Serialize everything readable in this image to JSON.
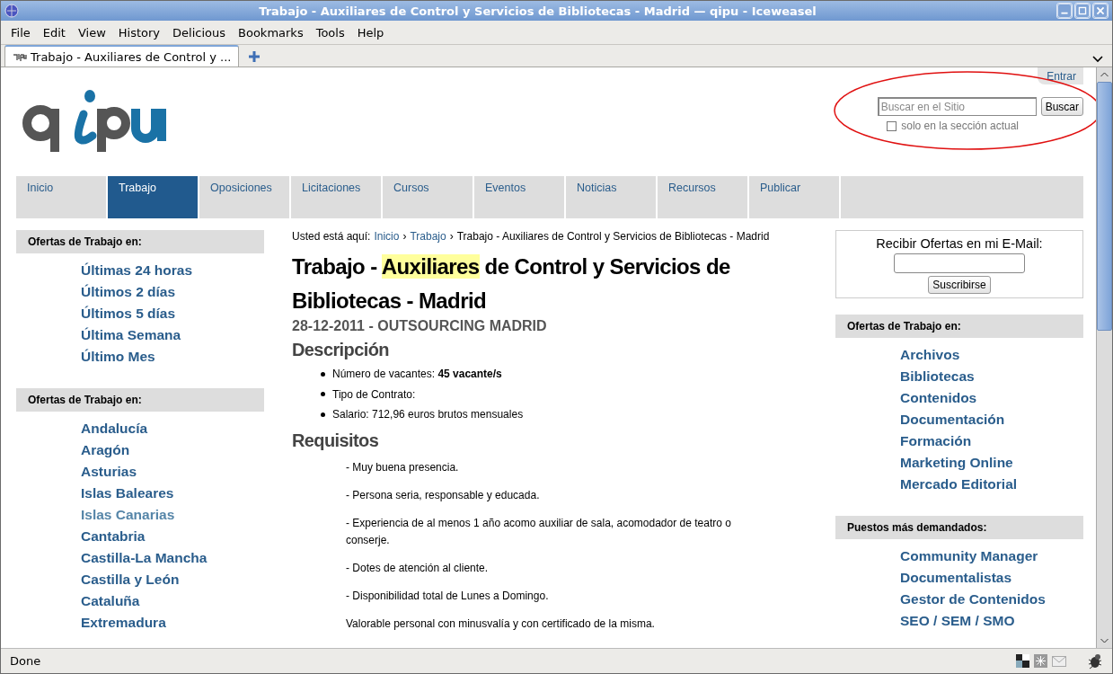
{
  "window": {
    "title": "Trabajo - Auxiliares de Control y Servicios de Bibliotecas - Madrid — qipu - Iceweasel"
  },
  "menu": [
    "File",
    "Edit",
    "View",
    "History",
    "Delicious",
    "Bookmarks",
    "Tools",
    "Help"
  ],
  "tabs": [
    {
      "label": "Trabajo - Auxiliares de Control y ...",
      "selected": true
    }
  ],
  "page": {
    "login": "Entrar",
    "search": {
      "placeholder": "Buscar en el Sitio",
      "button": "Buscar",
      "checkbox_label": "solo en la sección actual",
      "checked": false
    },
    "nav": [
      {
        "label": "Inicio",
        "selected": false
      },
      {
        "label": "Trabajo",
        "selected": true
      },
      {
        "label": "Oposiciones",
        "selected": false
      },
      {
        "label": "Licitaciones",
        "selected": false
      },
      {
        "label": "Cursos",
        "selected": false
      },
      {
        "label": "Eventos",
        "selected": false
      },
      {
        "label": "Noticias",
        "selected": false
      },
      {
        "label": "Recursos",
        "selected": false
      },
      {
        "label": "Publicar",
        "selected": false
      }
    ],
    "left_sections": [
      {
        "heading": "Ofertas de Trabajo en:",
        "links": [
          {
            "text": "Últimas 24 horas",
            "visited": false
          },
          {
            "text": "Últimos 2 días",
            "visited": false
          },
          {
            "text": "Últimos 5 días",
            "visited": false
          },
          {
            "text": "Última Semana",
            "visited": false
          },
          {
            "text": "Último Mes",
            "visited": false
          }
        ]
      },
      {
        "heading": "Ofertas de Trabajo en:",
        "links": [
          {
            "text": "Andalucía",
            "visited": false
          },
          {
            "text": "Aragón",
            "visited": false
          },
          {
            "text": "Asturias",
            "visited": false
          },
          {
            "text": "Islas Baleares",
            "visited": false
          },
          {
            "text": "Islas Canarias",
            "visited": true
          },
          {
            "text": "Cantabria",
            "visited": false
          },
          {
            "text": "Castilla-La Mancha",
            "visited": false
          },
          {
            "text": "Castilla y León",
            "visited": false
          },
          {
            "text": "Cataluña",
            "visited": false
          },
          {
            "text": "Extremadura",
            "visited": false
          }
        ]
      }
    ],
    "breadcrumb": {
      "label": "Usted está aquí:",
      "separator": "›",
      "items": [
        {
          "text": "Inicio",
          "link": true
        },
        {
          "text": "Trabajo",
          "link": true
        },
        {
          "text": "Trabajo - Auxiliares de Control y Servicios de Bibliotecas - Madrid",
          "link": false
        }
      ]
    },
    "heading": [
      {
        "text": "Trabajo - ",
        "highlighted": false
      },
      {
        "text": "Auxiliares",
        "highlighted": true
      },
      {
        "text": " de Control y Servicios de Bibliotecas - Madrid",
        "highlighted": false
      }
    ],
    "subtitle": "28-12-2011 - OUTSOURCING MADRID",
    "description_heading": "Descripción",
    "description": [
      "Número de vacantes: **45 vacante/s**",
      "Tipo de Contrato:",
      "Salario: 712,96 euros brutos mensuales"
    ],
    "requirements_heading": "Requisitos",
    "requirements": [
      "- Muy buena presencia.",
      "- Persona seria, responsable y educada.",
      "- Experiencia de al menos 1 año acomo auxiliar de sala, acomodador de teatro o conserje.",
      "- Dotes de atención al cliente.",
      "- Disponibilidad total de Lunes a Domingo."
    ],
    "note": "Valorable personal con minusvalía y con certificado de la misma.",
    "subscribe": {
      "label": "Recibir Ofertas en mi E-Mail:",
      "button": "Suscribirse"
    },
    "right_sections": [
      {
        "heading": "Ofertas de Trabajo en:",
        "links": [
          {
            "text": "Archivos",
            "visited": false
          },
          {
            "text": "Bibliotecas",
            "visited": false
          },
          {
            "text": "Contenidos",
            "visited": false
          },
          {
            "text": "Documentación",
            "visited": false
          },
          {
            "text": "Formación",
            "visited": false
          },
          {
            "text": "Marketing Online",
            "visited": false
          },
          {
            "text": "Mercado Editorial",
            "visited": false
          }
        ]
      },
      {
        "heading": "Puestos más demandados:",
        "links": [
          {
            "text": "Community Manager",
            "visited": false
          },
          {
            "text": "Documentalistas",
            "visited": false
          },
          {
            "text": "Gestor de Contenidos",
            "visited": false
          },
          {
            "text": "SEO / SEM / SMO",
            "visited": false
          }
        ]
      }
    ]
  },
  "status_bar": {
    "text": "Done"
  }
}
